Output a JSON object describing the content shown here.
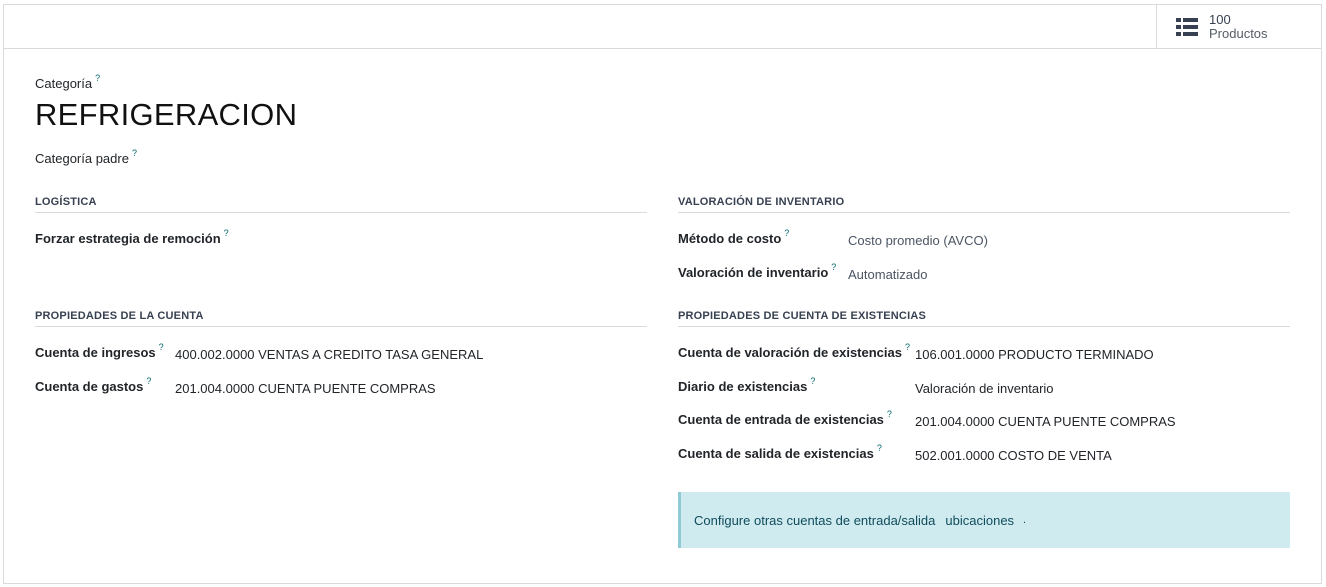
{
  "stat_button": {
    "value": "100",
    "label": "Productos",
    "icon": "list-icon"
  },
  "form": {
    "category_label": "Categoría",
    "category_name": "REFRIGERACION",
    "parent_label": "Categoría padre",
    "help_mark": "?"
  },
  "logistics": {
    "title": "LOGÍSTICA",
    "removal_label": "Forzar estrategia de remoción"
  },
  "account_props": {
    "title": "PROPIEDADES DE LA CUENTA",
    "income_label": "Cuenta de ingresos",
    "income_value": "400.002.0000 VENTAS A CREDITO TASA GENERAL",
    "expense_label": "Cuenta de gastos",
    "expense_value": "201.004.0000 CUENTA PUENTE COMPRAS"
  },
  "valuation": {
    "title": "VALORACIÓN DE INVENTARIO",
    "cost_method_label": "Método de costo",
    "cost_method_value": "Costo promedio (AVCO)",
    "valuation_label": "Valoración de inventario",
    "valuation_value": "Automatizado"
  },
  "stock_props": {
    "title": "PROPIEDADES DE CUENTA DE EXISTENCIAS",
    "valuation_account_label": "Cuenta de valoración de existencias",
    "valuation_account_value": "106.001.0000 PRODUCTO TERMINADO",
    "journal_label": "Diario de existencias",
    "journal_value": "Valoración de inventario",
    "input_label": "Cuenta de entrada de existencias",
    "input_value": "201.004.0000 CUENTA PUENTE COMPRAS",
    "output_label": "Cuenta de salida de existencias",
    "output_value": "502.001.0000 COSTO DE VENTA"
  },
  "alert": {
    "text": "Configure otras cuentas de entrada/salida",
    "link": "ubicaciones",
    "dot": "."
  }
}
